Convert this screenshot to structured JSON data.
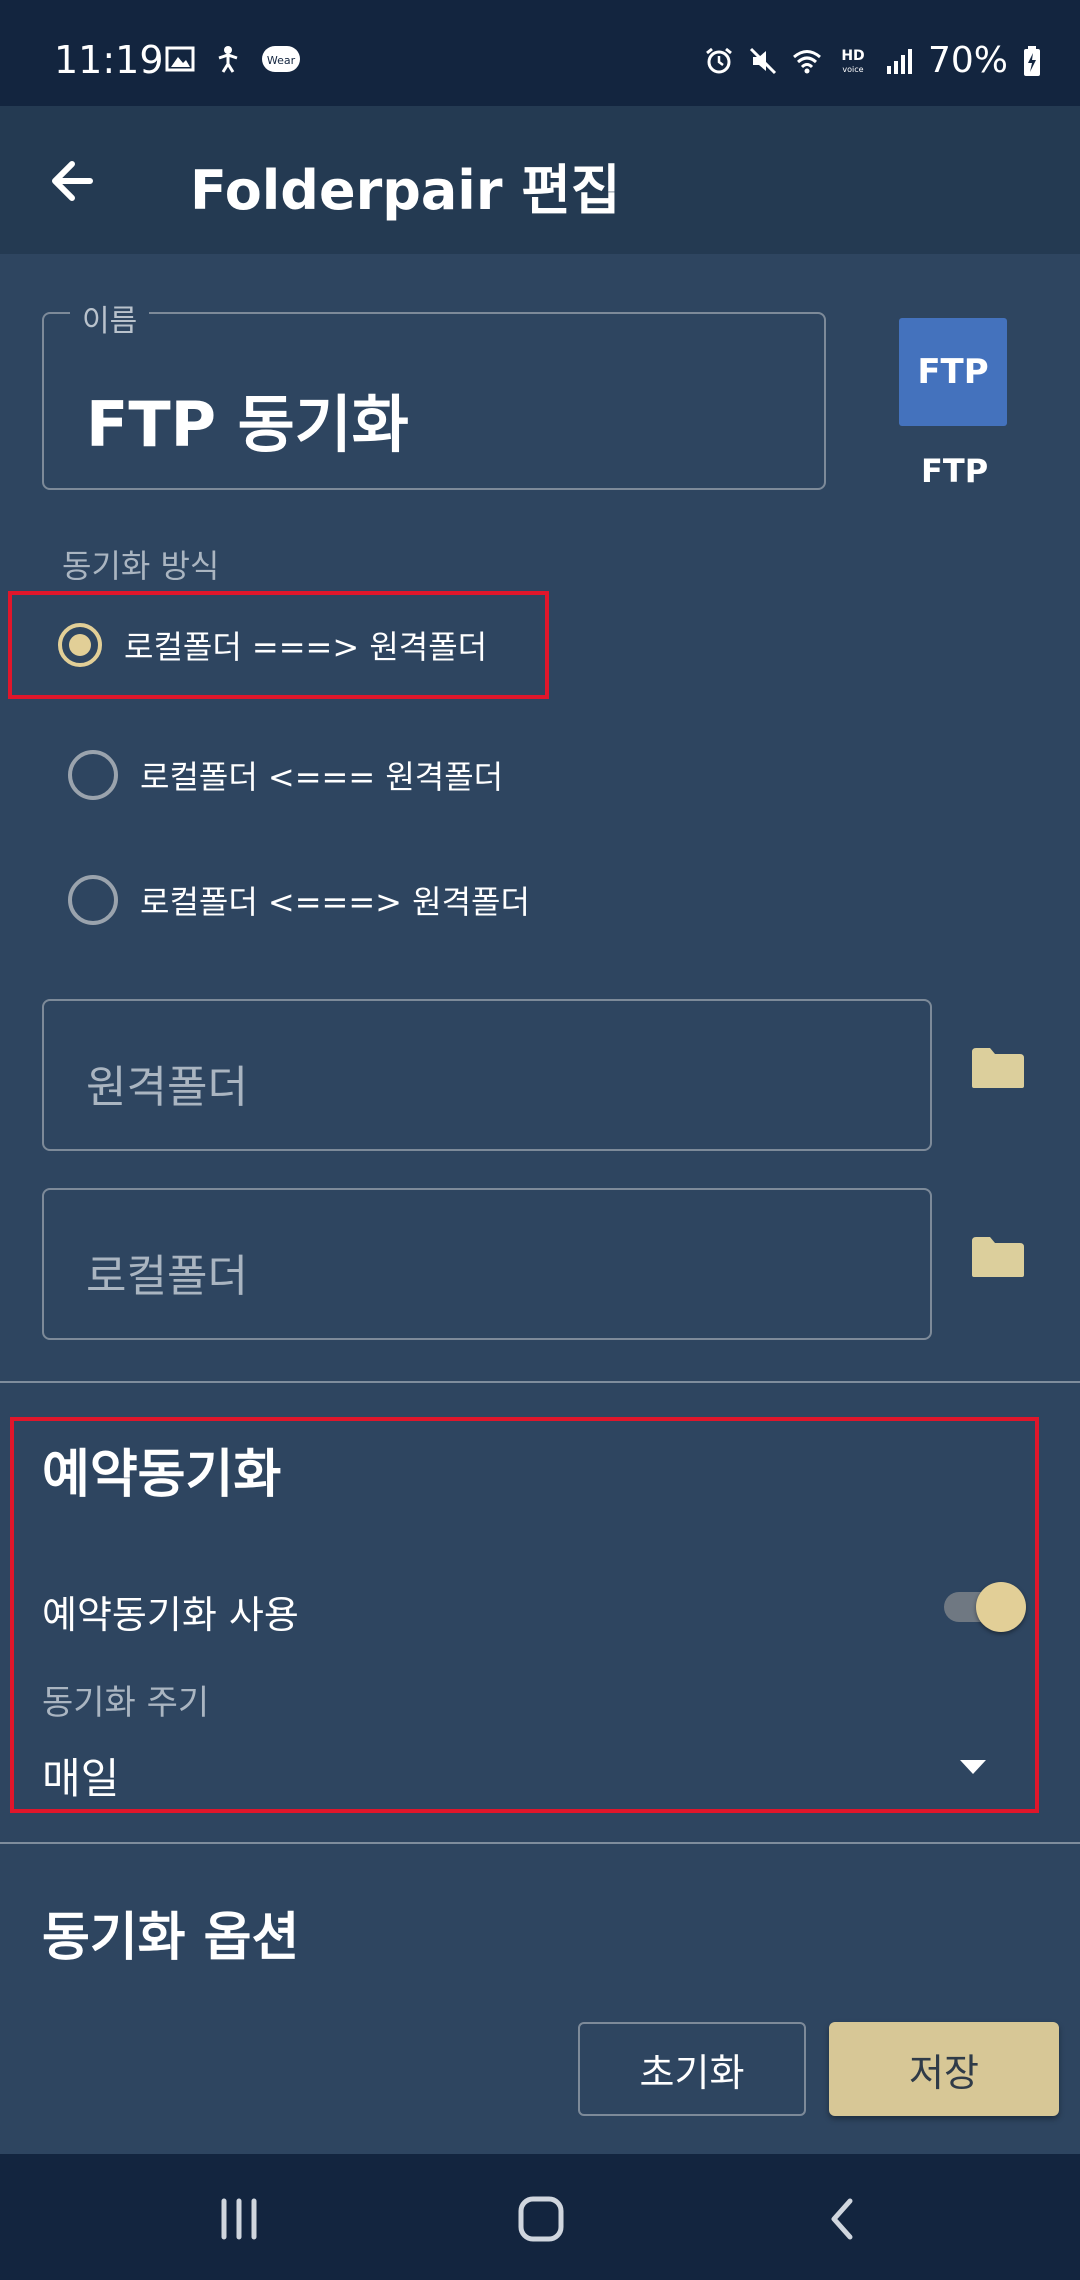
{
  "status_bar": {
    "time": "11:19",
    "battery": "70%",
    "icons": [
      "image-icon",
      "accessibility-icon",
      "wear-icon",
      "alarm-icon",
      "mute-icon",
      "wifi-icon",
      "hd-voice-icon",
      "signal-icon",
      "battery-icon"
    ]
  },
  "app_bar": {
    "title": "Folderpair 편집",
    "back_icon": "arrow-left-icon"
  },
  "name_field": {
    "label": "이름",
    "value": "FTP 동기화"
  },
  "protocol": {
    "badge_text": "FTP",
    "caption": "FTP",
    "color": "#4472bd"
  },
  "sync_method": {
    "label": "동기화 방식",
    "options": [
      {
        "label": "로컬폴더 ===> 원격폴더",
        "selected": true
      },
      {
        "label": "로컬폴더 <=== 원격폴더",
        "selected": false
      },
      {
        "label": "로컬폴더 <===> 원격폴더",
        "selected": false
      }
    ]
  },
  "folders": {
    "remote_placeholder": "원격폴더",
    "local_placeholder": "로컬폴더",
    "folder_icon": "folder-icon"
  },
  "schedule": {
    "title": "예약동기화",
    "use_label": "예약동기화 사용",
    "use_enabled": true,
    "period_label": "동기화 주기",
    "period_value": "매일"
  },
  "options": {
    "title": "동기화 옵션"
  },
  "actions": {
    "reset_label": "초기화",
    "save_label": "저장"
  },
  "nav_bar": {
    "icons": [
      "recents-icon",
      "home-icon",
      "back-icon"
    ]
  },
  "colors": {
    "background": "#2e4560",
    "app_bar": "#243a52",
    "status_bar": "#13253f",
    "accent": "#e2cf97",
    "save_button": "#d7c796",
    "highlight": "#e0162b"
  }
}
